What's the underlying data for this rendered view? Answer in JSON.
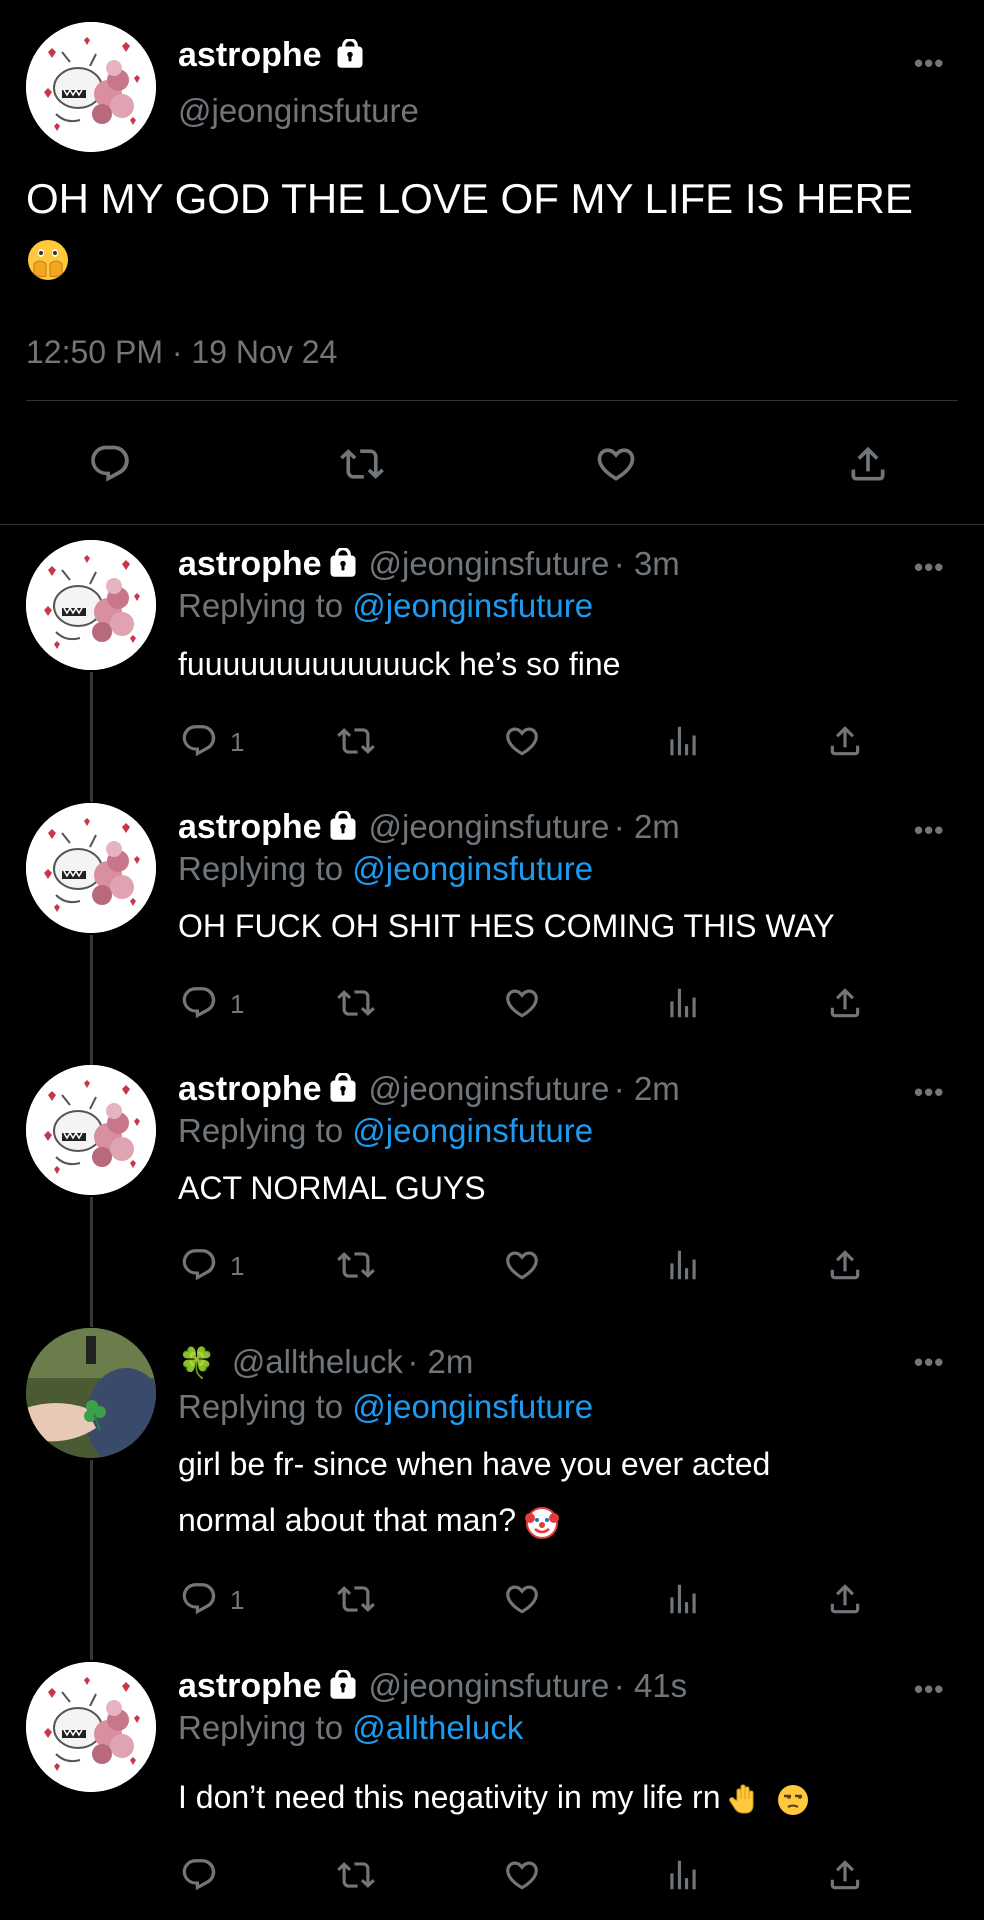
{
  "main_tweet": {
    "display_name": "astrophe",
    "handle": "@jeonginsfuture",
    "text": "OH MY GOD THE LOVE OF MY LIFE IS HERE",
    "emoji": "face-with-open-eyes-and-hand-over-mouth",
    "timestamp": "12:50 PM · 19 Nov 24",
    "more_label": "•••"
  },
  "replies": [
    {
      "display_name": "astrophe",
      "handle": "@jeonginsfuture",
      "time": "· 3m",
      "replying_prefix": "Replying to",
      "replying_to": "@jeonginsfuture",
      "text": "fuuuuuuuuuuuuuck he’s so fine",
      "reply_count": "1",
      "more_label": "•••"
    },
    {
      "display_name": "astrophe",
      "handle": "@jeonginsfuture",
      "time": "· 2m",
      "replying_prefix": "Replying to",
      "replying_to": "@jeonginsfuture",
      "text": "OH FUCK OH SHIT HES COMING THIS WAY",
      "reply_count": "1",
      "more_label": "•••"
    },
    {
      "display_name": "astrophe",
      "handle": "@jeonginsfuture",
      "time": "· 2m",
      "replying_prefix": "Replying to",
      "replying_to": "@jeonginsfuture",
      "text": "ACT NORMAL GUYS",
      "reply_count": "1",
      "more_label": "•••"
    },
    {
      "display_name": "🍀",
      "handle": "@alltheluck",
      "time": "· 2m",
      "replying_prefix": "Replying to",
      "replying_to": "@jeonginsfuture",
      "text_line1": "girl be fr- since when have you ever acted",
      "text_line2": "normal about that man?",
      "reply_count": "1",
      "more_label": "•••"
    },
    {
      "display_name": "astrophe",
      "handle": "@jeonginsfuture",
      "time": "· 41s",
      "replying_prefix": "Replying to",
      "replying_to": "@alltheluck",
      "text": "I don’t need this negativity in my life rn",
      "reply_count": "",
      "more_label": "•••"
    }
  ],
  "colors": {
    "accent": "#1d9bf0",
    "muted": "#71767b",
    "background": "#000000",
    "text": "#ffffff"
  }
}
